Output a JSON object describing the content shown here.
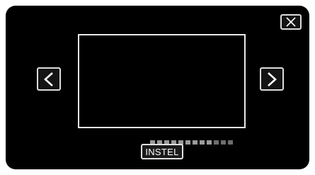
{
  "dialog": {
    "set_label": "INSTEL"
  },
  "progress": {
    "segments_total": 12,
    "segments_filled": 9
  },
  "icons": {
    "close": "close-icon",
    "prev": "chevron-left-icon",
    "next": "chevron-right-icon"
  },
  "colors": {
    "background": "#000000",
    "border": "#e8e8e8",
    "text": "#ffffff"
  }
}
